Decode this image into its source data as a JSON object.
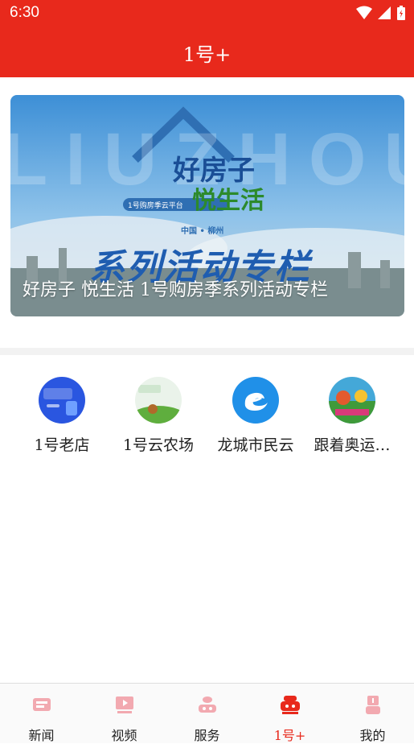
{
  "status_bar": {
    "time": "6:30"
  },
  "app_bar": {
    "title": "1号+"
  },
  "banner": {
    "watermark": "LIUZHOU",
    "logo_line1": "好房子",
    "logo_line2": "悦生活",
    "platform_tag": "1号购房季云平台",
    "location": "中国 • 柳州",
    "big_text": "系列活动专栏",
    "caption": "好房子  悦生活   1号购房季系列活动专栏"
  },
  "services": [
    {
      "label": "1号老店",
      "icon": "old-store-icon"
    },
    {
      "label": "1号云农场",
      "icon": "cloud-farm-icon"
    },
    {
      "label": "龙城市民云",
      "icon": "citizen-cloud-icon"
    },
    {
      "label": "跟着奥运…",
      "icon": "olympics-icon"
    }
  ],
  "bottom_nav": [
    {
      "label": "新闻",
      "icon": "news-icon",
      "active": false
    },
    {
      "label": "视频",
      "icon": "video-icon",
      "active": false
    },
    {
      "label": "服务",
      "icon": "service-icon",
      "active": false
    },
    {
      "label": "1号+",
      "icon": "one-plus-icon",
      "active": true
    },
    {
      "label": "我的",
      "icon": "profile-icon",
      "active": false
    }
  ],
  "colors": {
    "brand_red": "#e8291c",
    "nav_icon_pink": "#f0a0a8"
  }
}
